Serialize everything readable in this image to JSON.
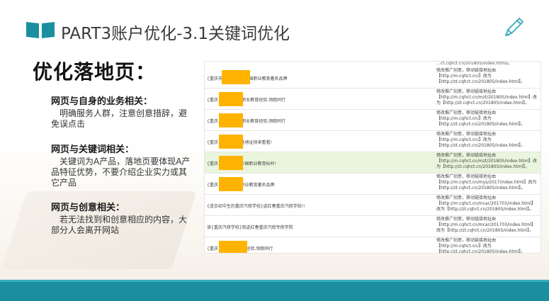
{
  "header": {
    "title": "PART3账户优化-3.1关键词优化",
    "logo_icon": "book-icon",
    "edit_icon": "pencil-icon",
    "accent_color": "#1b8fa0"
  },
  "main": {
    "title": "优化落地页："
  },
  "sections": [
    {
      "heading": "网页与自身的业务相关：",
      "body": "明确服务人群，注意创意措辞，避免误点击"
    },
    {
      "heading": "网页与关键词相关：",
      "body": "关键词为A产品，落地页要体现A产品特征优势，不要介绍企业实力或其它产品"
    },
    {
      "heading": "网页与创意相关：",
      "body": "若无法找到和创意相应的内容，大部分人会离开网站"
    }
  ],
  "screenshot": {
    "top_strip": "…ct.cqhct.cn/201805/index.html】。",
    "rows": [
      {
        "text": "{重庆市                    学校地址},中国职业教育著名品牌",
        "desc": "修改推广创意，移动链接地址由【http://m.cqhct.cn/】改为【http://zt.cqhct.cn/201805/index.html】。"
      },
      {
        "text": "{重庆               地址},20年职业教育经验,领跑同行",
        "desc": "修改推广创意，移动链接地址由【http://m.cqhct.cn/mzt/201805/index.html】改为【http://zt.cqhct.cn/201805/index.html】。"
      },
      {
        "text": "{重庆               地址},20年职业教育经验,领跑同行",
        "desc": "修改推广创意，移动链接地址由【http://m.cqhct.cn/】改为【http://zt.cqhct.cn/201805/index.html】。"
      },
      {
        "text": "{重庆               周地址},揽胜地址快来看看!",
        "desc": "修改推广创意，移动链接地址由【http://m.cqhct.cn/】改为【http://zt.cqhct.cn/201805/index.html】。"
      },
      {
        "text": "{重庆               学校地址},中国职业教育标杆!",
        "desc": "修改推广创意，移动链接地址由【http://m.cqhct.cn/mzt/201805/index.html】改为【http://zt.cqhct.cn/201805/index.html】。"
      },
      {
        "text": "{重庆               地址},中国职业教育著名品牌",
        "desc": "修改推广创意，移动链接地址由【http://m.cqhct.cn/mys/2017/index.html】改为【http://zt.cqhct.cn/201805/index.html】。"
      },
      {
        "text": "{适合初中生的重庆汽修学校}选红春重庆汽修学校!!",
        "desc": "修改推广创意，移动链接地址由【http://m.cqhct.cn/mcar/201703/index.html】改为【http://zt.cqhct.cn/201805/index.html】。"
      },
      {
        "text": "读{重庆汽修学校}就选红春重庆汽修专修学院",
        "desc": "修改推广创意，移动链接地址由【http://m.cqhct.cn/mcar/201703/index.html】改为【http://zt.cqhct.cn/201805/index.html】。"
      },
      {
        "text": "{重庆               20年职业教育经验,领跑同行",
        "desc": "修改推广创意，移动链接地址由【http://m.cqhct.cn/】改为【http://zt.cqhct.cn/201805/index.html】。"
      }
    ]
  }
}
